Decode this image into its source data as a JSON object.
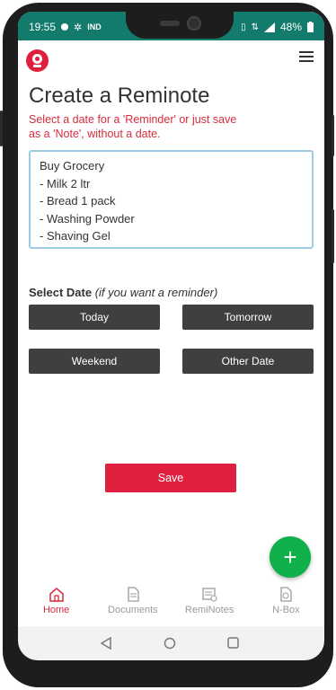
{
  "status_bar": {
    "time": "19:55",
    "network_label": "IND",
    "battery": "48%"
  },
  "app": {
    "title": "Create a Reminote",
    "subtitle": "Select a date for a 'Reminder' or just save as a 'Note', without a date."
  },
  "note": {
    "text": "Buy Grocery\n- Milk 2 ltr\n- Bread 1 pack\n- Washing Powder\n- Shaving Gel"
  },
  "date_section": {
    "label": "Select Date",
    "hint": "(if you want a reminder)",
    "buttons": [
      "Today",
      "Tomorrow",
      "Weekend",
      "Other Date"
    ]
  },
  "save_label": "Save",
  "fab_label": "+",
  "bottom_nav": [
    {
      "label": "Home",
      "icon": "home-icon",
      "active": true
    },
    {
      "label": "Documents",
      "icon": "document-icon",
      "active": false
    },
    {
      "label": "RemiNotes",
      "icon": "reminote-icon",
      "active": false
    },
    {
      "label": "N-Box",
      "icon": "nbox-icon",
      "active": false
    }
  ],
  "colors": {
    "accent_red": "#df1f3d",
    "status_bar": "#127b6c",
    "dark_button": "#3f3f3f",
    "fab_green": "#10b14b"
  }
}
